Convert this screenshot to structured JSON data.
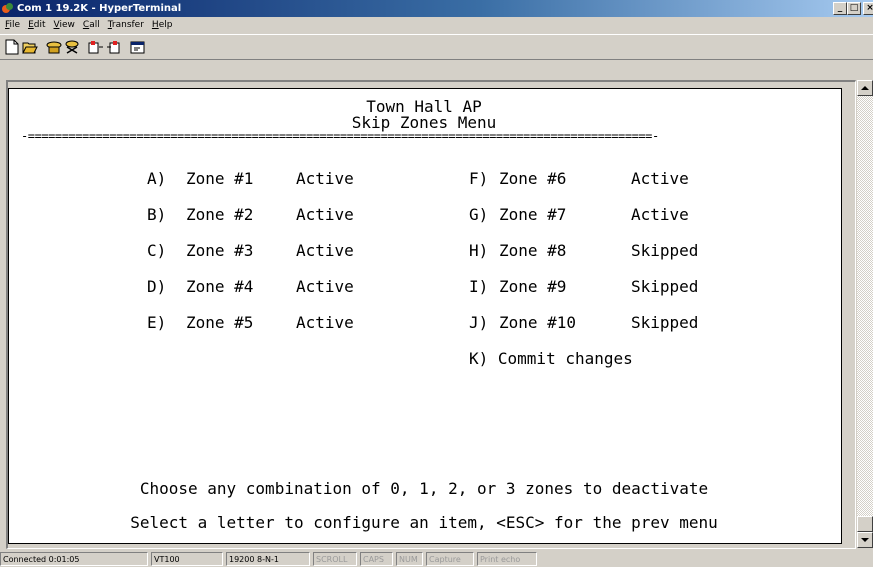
{
  "window": {
    "title": "Com 1 19.2K - HyperTerminal",
    "controls": {
      "minimize": "_",
      "maximize": "□",
      "close": "×"
    }
  },
  "menu": [
    {
      "label": "File",
      "accel": "F",
      "rest": "ile"
    },
    {
      "label": "Edit",
      "accel": "E",
      "rest": "dit"
    },
    {
      "label": "View",
      "accel": "V",
      "rest": "iew"
    },
    {
      "label": "Call",
      "accel": "C",
      "rest": "all"
    },
    {
      "label": "Transfer",
      "accel": "T",
      "rest": "ransfer"
    },
    {
      "label": "Help",
      "accel": "H",
      "rest": "elp"
    }
  ],
  "toolbar": {
    "buttons": [
      "new-connection-icon",
      "open-icon",
      "connect-icon",
      "disconnect-icon",
      "send-icon",
      "receive-icon",
      "properties-icon"
    ]
  },
  "terminal": {
    "header_line1": "Town Hall AP",
    "header_line2": "Skip Zones Menu",
    "separator": "-============================================================================================-",
    "zones_left": [
      {
        "key": "A)",
        "zone": "Zone #1",
        "status": "Active"
      },
      {
        "key": "B)",
        "zone": "Zone #2",
        "status": "Active"
      },
      {
        "key": "C)",
        "zone": "Zone #3",
        "status": "Active"
      },
      {
        "key": "D)",
        "zone": "Zone #4",
        "status": "Active"
      },
      {
        "key": "E)",
        "zone": "Zone #5",
        "status": "Active"
      }
    ],
    "zones_right": [
      {
        "key": "F)",
        "zone": "Zone #6",
        "status": "Active"
      },
      {
        "key": "G)",
        "zone": "Zone #7",
        "status": "Active"
      },
      {
        "key": "H)",
        "zone": "Zone #8",
        "status": "Skipped"
      },
      {
        "key": "I)",
        "zone": "Zone #9",
        "status": "Skipped"
      },
      {
        "key": "J)",
        "zone": "Zone #10",
        "status": "Skipped"
      }
    ],
    "commit": "K) Commit changes",
    "hint": "Choose any combination of 0, 1, 2, or 3 zones to deactivate",
    "prompt": "Select a letter to configure an item, <ESC> for the prev menu"
  },
  "statusbar": {
    "connected": "Connected 0:01:05",
    "emulation": "VT100",
    "settings": "19200 8-N-1",
    "scroll": "SCROLL",
    "caps": "CAPS",
    "num": "NUM",
    "capture": "Capture",
    "print_echo": "Print echo"
  }
}
